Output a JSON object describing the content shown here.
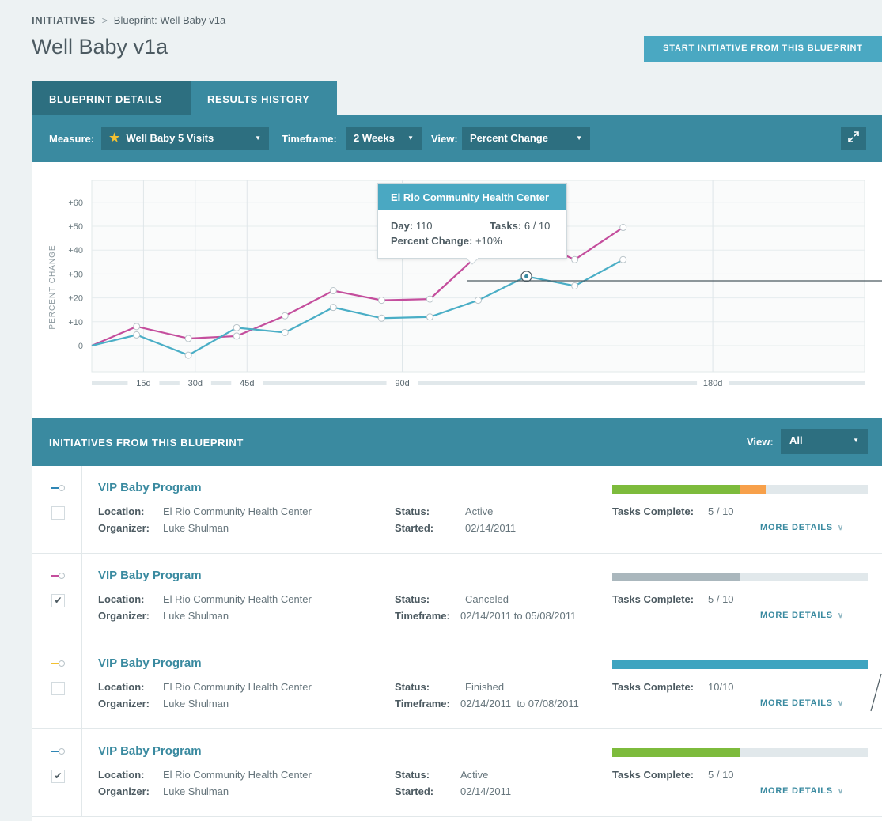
{
  "breadcrumb": {
    "root": "INITIATIVES",
    "separator": ">",
    "current": "Blueprint: Well Baby v1a"
  },
  "page_title": "Well Baby v1a",
  "start_button": "START INITIATIVE FROM THIS BLUEPRINT",
  "tabs": [
    {
      "label": "BLUEPRINT DETAILS"
    },
    {
      "label": "RESULTS HISTORY",
      "active": true
    }
  ],
  "filters": {
    "measure_label": "Measure:",
    "measure_value": "Well Baby 5 Visits",
    "timeframe_label": "Timeframe:",
    "timeframe_value": "2 Weeks",
    "view_label": "View:",
    "view_value": "Percent Change",
    "expand_icon": "expand-icon"
  },
  "chart_data": {
    "type": "line",
    "ylabel": "PERCENT CHANGE",
    "ylim": [
      -5,
      65
    ],
    "y_ticks": [
      "+60",
      "+50",
      "+40",
      "+30",
      "+20",
      "+10",
      "0"
    ],
    "x_ticks": [
      "15d",
      "30d",
      "45d",
      "90d",
      "180d"
    ],
    "x_tick_values": [
      15,
      30,
      45,
      90,
      180
    ],
    "xlim": [
      0,
      224
    ],
    "series": [
      {
        "color": "#c44e9d",
        "points": [
          [
            0,
            0
          ],
          [
            13,
            8
          ],
          [
            28,
            3
          ],
          [
            42,
            4
          ],
          [
            56,
            12.5
          ],
          [
            70,
            23
          ],
          [
            84,
            19
          ],
          [
            98,
            19.5
          ],
          [
            112,
            38
          ],
          [
            126,
            45
          ],
          [
            140,
            36
          ],
          [
            154,
            49.5
          ]
        ]
      },
      {
        "color": "#4aaec6",
        "points": [
          [
            0,
            0
          ],
          [
            13,
            4.5
          ],
          [
            28,
            -4
          ],
          [
            42,
            7.5
          ],
          [
            56,
            5.5
          ],
          [
            70,
            16
          ],
          [
            84,
            11.5
          ],
          [
            98,
            12
          ],
          [
            112,
            19
          ],
          [
            126,
            29
          ],
          [
            140,
            25
          ],
          [
            154,
            36
          ]
        ]
      }
    ],
    "tooltip": {
      "title": "El Rio Community Health Center",
      "day_label": "Day:",
      "day_value": "110",
      "tasks_label": "Tasks:",
      "tasks_value": "6 / 10",
      "change_label": "Percent Change:",
      "change_value": "+10%"
    }
  },
  "initiatives": {
    "title": "INITIATIVES FROM THIS BLUEPRINT",
    "view_label": "View:",
    "view_value": "All",
    "rows": [
      {
        "legend_color": "#2f86b5",
        "checked": false,
        "name": "VIP Baby Program",
        "location_label": "Location:",
        "location": "El Rio Community Health Center",
        "organizer_label": "Organizer:",
        "organizer": "Luke Shulman",
        "status_label": "Status:",
        "status": "Active",
        "date_label": "Started:",
        "date": "02/14/2011",
        "tasks_label": "Tasks Complete:",
        "tasks": "5 / 10",
        "progress": [
          {
            "fraction": 0.5,
            "color": "#7dbb3c"
          },
          {
            "fraction": 0.1,
            "color": "#f7a04a"
          }
        ],
        "more": "MORE DETAILS"
      },
      {
        "legend_color": "#c44e9d",
        "checked": true,
        "name": "VIP Baby Program",
        "location_label": "Location:",
        "location": "El Rio Community Health Center",
        "organizer_label": "Organizer:",
        "organizer": "Luke Shulman",
        "status_label": "Status:",
        "status": "Canceled",
        "date_label": "Timeframe:",
        "date": "02/14/2011 to 05/08/2011",
        "tasks_label": "Tasks Complete:",
        "tasks": "5 / 10",
        "progress": [
          {
            "fraction": 0.5,
            "color": "#aab7bd"
          }
        ],
        "more": "MORE DETAILS"
      },
      {
        "legend_color": "#f2c031",
        "checked": false,
        "name": "VIP Baby Program",
        "location_label": "Location:",
        "location": "El Rio Community Health Center",
        "organizer_label": "Organizer:",
        "organizer": "Luke Shulman",
        "status_label": "Status:",
        "status": "Finished",
        "date_label": "Timeframe:",
        "date": "02/14/2011  to 07/08/2011",
        "tasks_label": "Tasks Complete:",
        "tasks": "10/10",
        "progress": [
          {
            "fraction": 1.0,
            "color": "#3ea4c0"
          }
        ],
        "more": "MORE DETAILS"
      },
      {
        "legend_color": "#2f86b5",
        "checked": true,
        "name": "VIP Baby Program",
        "location_label": "Location:",
        "location": "El Rio Community Health Center",
        "organizer_label": "Organizer:",
        "organizer": "Luke Shulman",
        "status_label": "Status:",
        "status": "Active",
        "date_label": "Started:",
        "date": "02/14/2011",
        "tasks_label": "Tasks Complete:",
        "tasks": "5 / 10",
        "progress": [
          {
            "fraction": 0.5,
            "color": "#7dbb3c"
          }
        ],
        "more": "MORE DETAILS"
      }
    ]
  }
}
